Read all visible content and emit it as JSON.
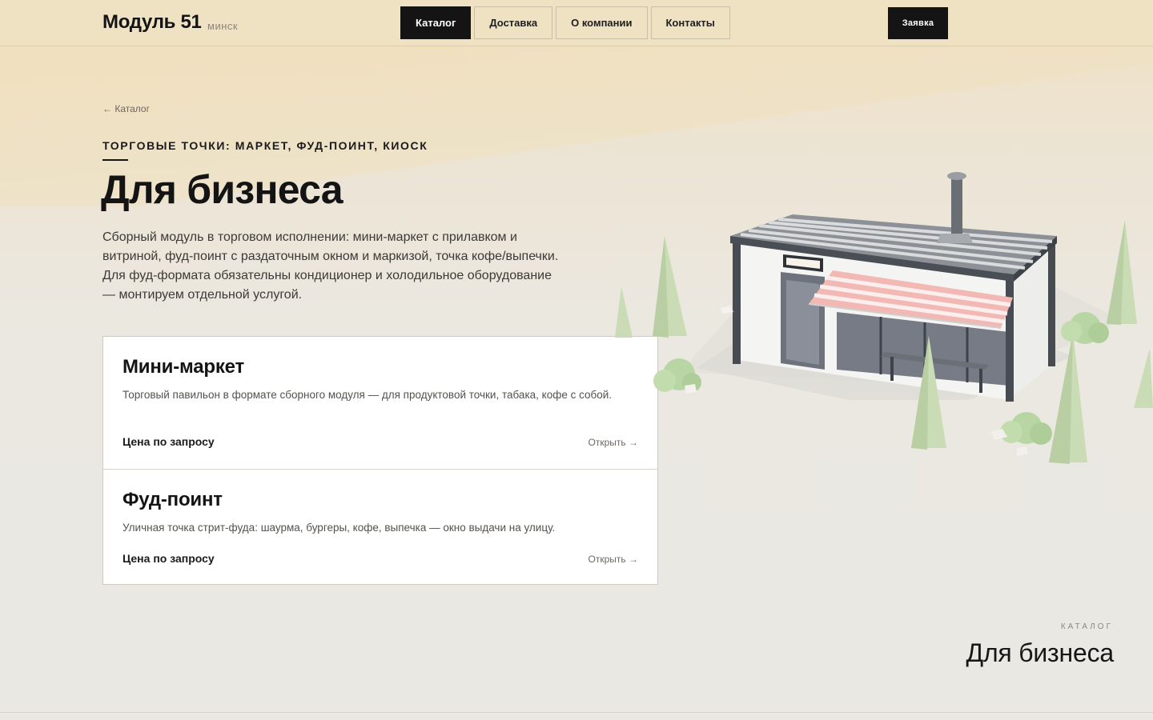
{
  "header": {
    "logo": "Модуль 51",
    "city": "минск",
    "nav": [
      {
        "label": "Каталог",
        "active": true
      },
      {
        "label": "Доставка",
        "active": false
      },
      {
        "label": "О компании",
        "active": false
      },
      {
        "label": "Контакты",
        "active": false
      }
    ],
    "cta_label": "Заявка"
  },
  "breadcrumb": {
    "back_label": "← Каталог"
  },
  "hero": {
    "eyebrow": "ТОРГОВЫЕ ТОЧКИ: МАРКЕТ, ФУД-ПОИНТ, КИОСК",
    "title": "Для бизнеса",
    "lead": "Сборный модуль в торговом исполнении: мини-маркет с прилавком и витриной, фуд-поинт с раздаточным окном и маркизой, точка кофе/выпечки. Для фуд-формата обязательны кондиционер и холодильное оборудование — монтируем отдельной услугой."
  },
  "products": [
    {
      "title": "Мини-маркет",
      "description": "Торговый павильон в формате сборного модуля — для продуктовой точки, табака, кофе с собой.",
      "price": "Цена по запросу",
      "open_label": "Открыть →"
    },
    {
      "title": "Фуд-поинт",
      "description": "Уличная точка стрит-фуда: шаурма, бургеры, кофе, выпечка — окно выдачи на улицу.",
      "price": "Цена по запросу",
      "open_label": "Открыть →"
    }
  ],
  "section_caption": {
    "small": "КАТАЛОГ",
    "big": "Для бизнеса"
  },
  "colors": {
    "accent": "#141414",
    "header_bg": "#efe2c3",
    "awning": "#f2b8b3",
    "tree": "#c9dcb5"
  }
}
